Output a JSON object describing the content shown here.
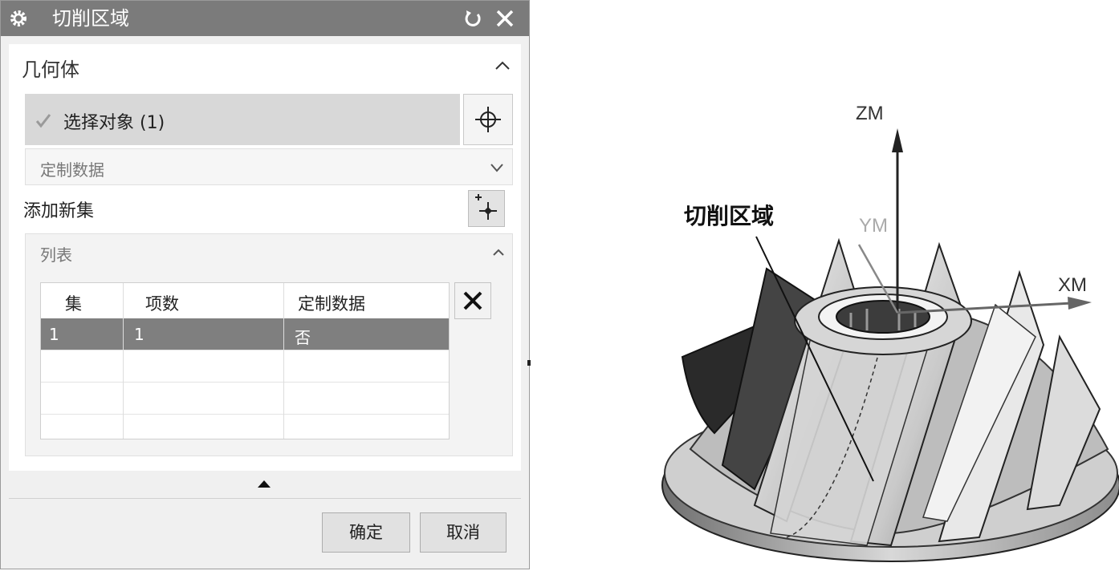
{
  "dialog": {
    "title": "切削区域",
    "geometry_section": "几何体",
    "select_object_label": "选择对象 (1)",
    "custom_data_label": "定制数据",
    "add_new_set_label": "添加新集",
    "list_section": "列表",
    "table": {
      "headers": [
        "集",
        "项数",
        "定制数据"
      ],
      "rows": [
        [
          "1",
          "1",
          "否"
        ]
      ]
    },
    "ok_label": "确定",
    "cancel_label": "取消"
  },
  "viewport": {
    "callout_label": "切削区域",
    "axes": {
      "z": "ZM",
      "y": "YM",
      "x": "XM"
    }
  },
  "icons": [
    "gear-icon",
    "reset-icon",
    "close-icon",
    "chevron-up-icon",
    "chevron-down-icon",
    "checkmark-icon",
    "crosshair-icon",
    "add-set-icon",
    "delete-icon",
    "collapse-triangle-icon"
  ]
}
